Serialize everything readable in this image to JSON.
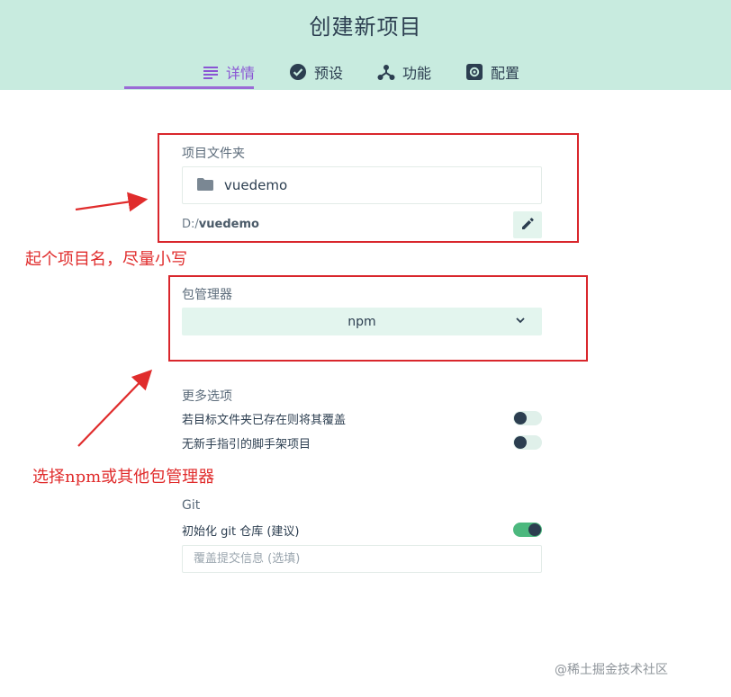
{
  "header": {
    "title": "创建新项目",
    "tabs": [
      {
        "label": "详情",
        "icon": "details-list-icon",
        "active": true
      },
      {
        "label": "预设",
        "icon": "check-circle-icon",
        "active": false
      },
      {
        "label": "功能",
        "icon": "feature-branch-icon",
        "active": false
      },
      {
        "label": "配置",
        "icon": "gear-icon",
        "active": false
      }
    ],
    "active_color": "#8a55d4",
    "background": "#c8ebdf"
  },
  "project_folder": {
    "label": "项目文件夹",
    "value": "vuedemo",
    "path_prefix": "D:/",
    "path_name": "vuedemo"
  },
  "package_manager": {
    "label": "包管理器",
    "selected": "npm"
  },
  "more_options": {
    "label": "更多选项",
    "items": [
      {
        "label": "若目标文件夹已存在则将其覆盖",
        "enabled": false
      },
      {
        "label": "无新手指引的脚手架项目",
        "enabled": false
      }
    ]
  },
  "git": {
    "label": "Git",
    "init_label": "初始化 git 仓库 (建议)",
    "init_enabled": true,
    "commit_placeholder": "覆盖提交信息 (选填)"
  },
  "annotations": {
    "name_hint": "起个项目名，尽量小写",
    "pm_hint": "选择npm或其他包管理器",
    "color": "#d9262c"
  },
  "watermark": "@稀土掘金技术社区"
}
